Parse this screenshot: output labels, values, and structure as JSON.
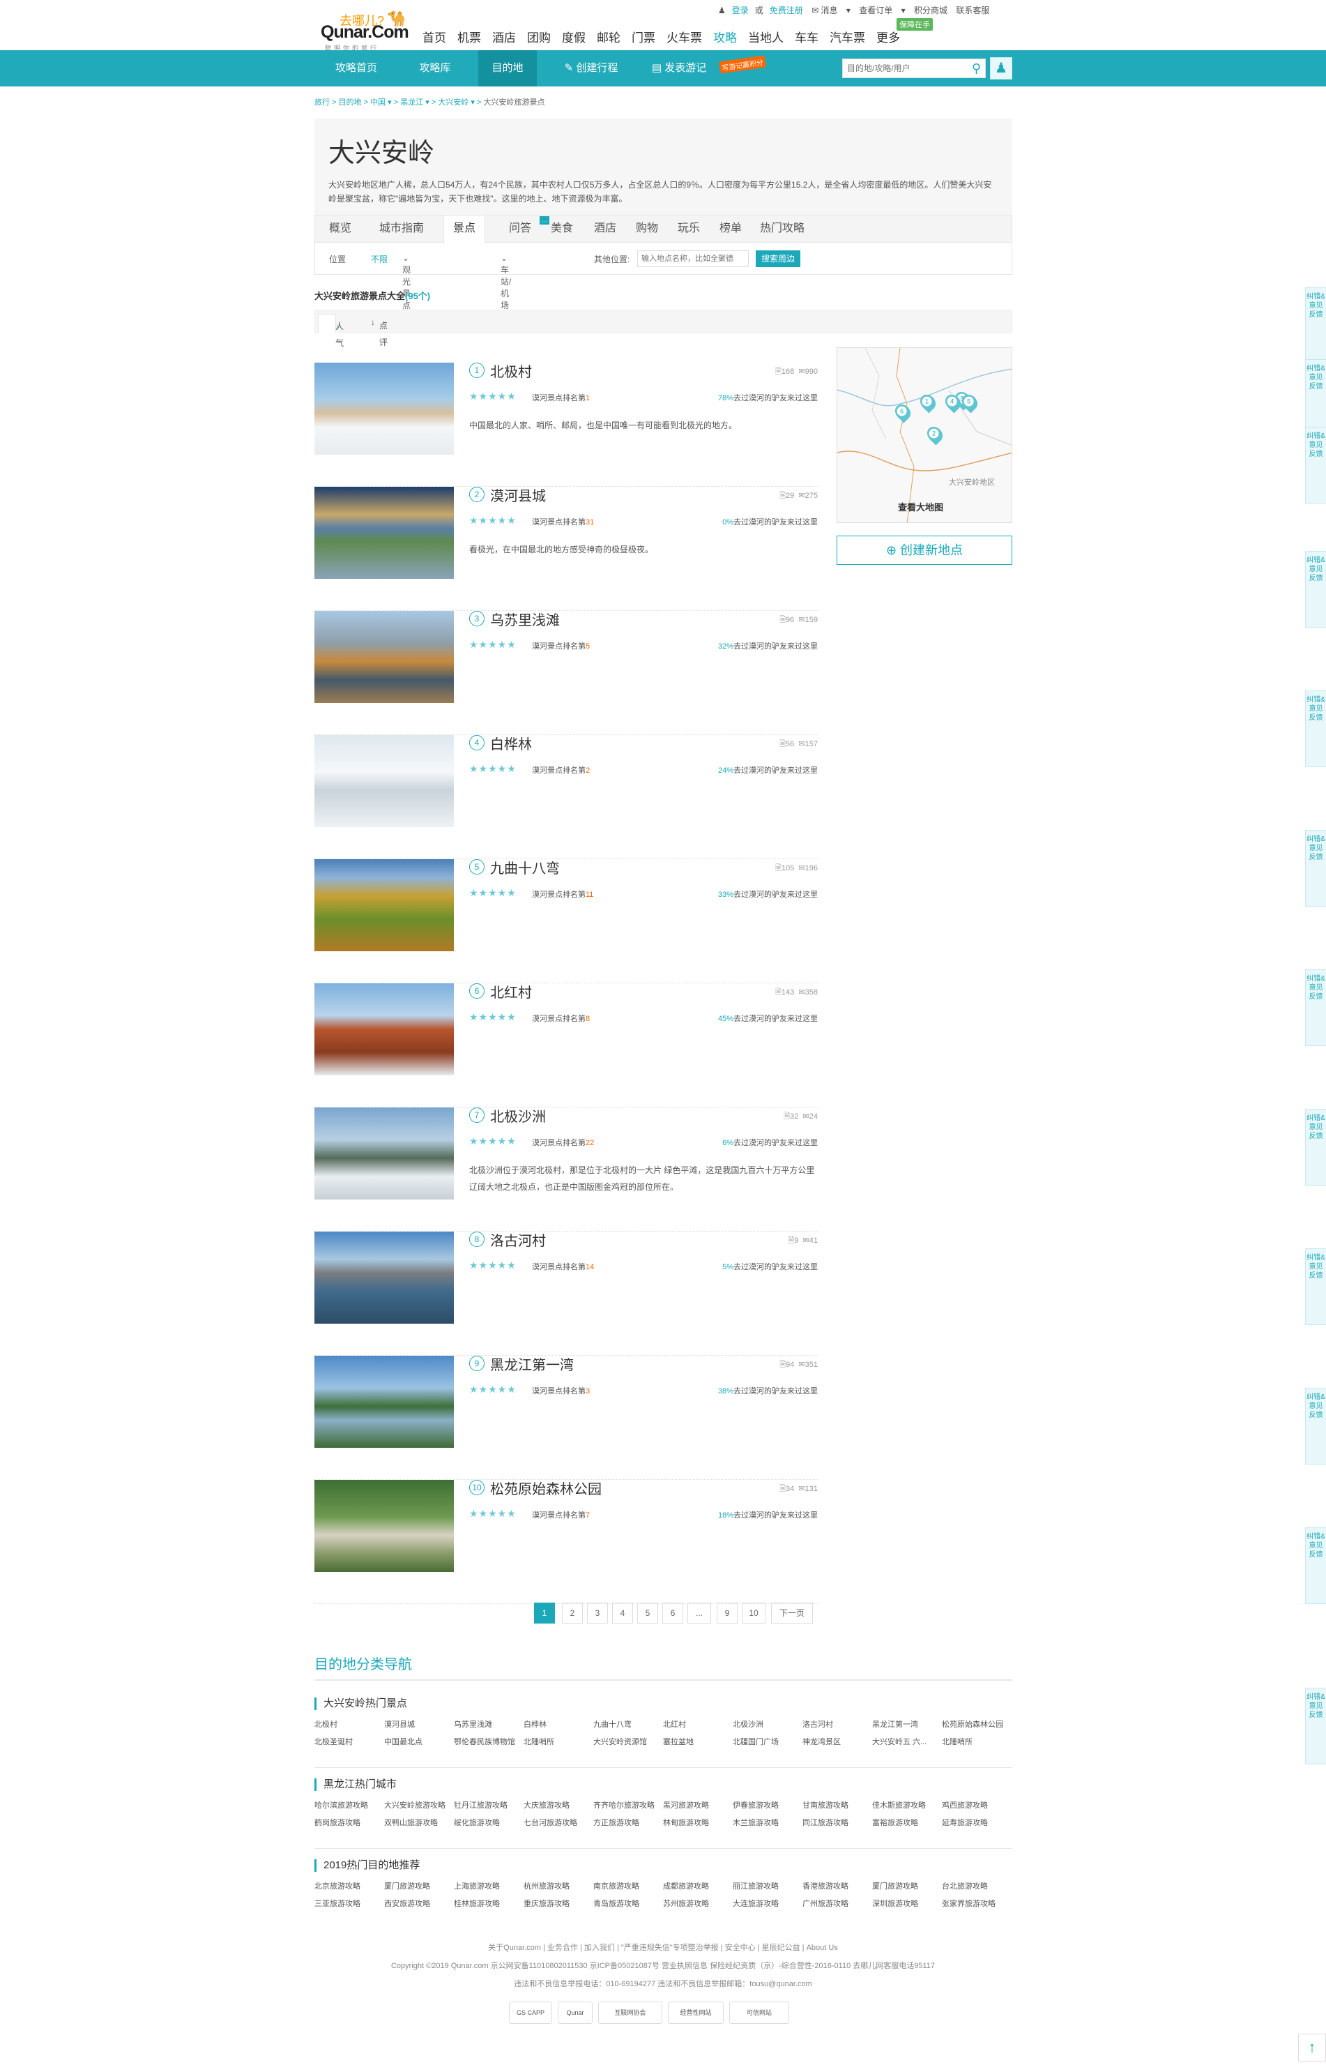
{
  "header": {
    "logo_top": "去哪儿?",
    "logo_main": "Qunar.Com",
    "logo_sub": "聪明你的旅行",
    "login": "登录",
    "or": "或",
    "register": "免费注册",
    "messages": "消息",
    "orders": "查看订单",
    "points_mall": "积分商城",
    "service": "联系客服",
    "guarantee_badge": "保障在手",
    "nav": [
      "首页",
      "机票",
      "酒店",
      "团购",
      "度假",
      "邮轮",
      "门票",
      "火车票",
      "攻略",
      "当地人",
      "车车",
      "汽车票",
      "更多"
    ]
  },
  "subnav": {
    "items": [
      "攻略首页",
      "攻略库",
      "目的地",
      "创建行程",
      "发表游记"
    ],
    "new_tag": "写游记赢积分",
    "search_placeholder": "目的地/攻略/用户"
  },
  "breadcrumb": [
    "旅行",
    "目的地",
    "中国",
    "黑龙江",
    "大兴安岭",
    "大兴安岭旅游景点"
  ],
  "destination": {
    "title": "大兴安岭",
    "intro": "大兴安岭地区地广人稀，总人口54万人，有24个民族，其中农村人口仅5万多人，占全区总人口的9％。人口密度为每平方公里15.2人，是全省人均密度最低的地区。人们赞美大兴安岭是聚宝盆，称它\"遍地皆为宝，天下也难找\"。这里的地上、地下资源极为丰富。"
  },
  "tabs": [
    "概览",
    "城市指南",
    "景点",
    "问答",
    "美食",
    "酒店",
    "购物",
    "玩乐",
    "榜单",
    "热门攻略"
  ],
  "filter": {
    "location": "位置",
    "any": "不限",
    "scenic": "观光景点",
    "station": "车站/机场",
    "other": "其他位置:",
    "input_placeholder": "输入地点名称，比如全聚德",
    "search_btn": "搜索周边"
  },
  "summary": {
    "text": "大兴安岭旅游景点大全",
    "count": "(95个)"
  },
  "sort": [
    "人气",
    "点评"
  ],
  "pois": [
    {
      "idx": "1",
      "name": "北极村",
      "notes": "168",
      "comments": "990",
      "rank_label": "漠河景点排名第",
      "rank": "1",
      "pct": "78%",
      "pct_text": "去过漠河的驴友来过这里",
      "desc": "中国最北的人家、哨所、邮局，也是中国唯一有可能看到北极光的地方。",
      "stars": "★★★★★"
    },
    {
      "idx": "2",
      "name": "漠河县城",
      "notes": "29",
      "comments": "275",
      "rank_label": "漠河景点排名第",
      "rank": "31",
      "pct": "0%",
      "pct_text": "去过漠河的驴友来过这里",
      "desc": "看极光，在中国最北的地方感受神奇的极昼极夜。",
      "stars": "★★★★★"
    },
    {
      "idx": "3",
      "name": "乌苏里浅滩",
      "notes": "96",
      "comments": "159",
      "rank_label": "漠河景点排名第",
      "rank": "5",
      "pct": "32%",
      "pct_text": "去过漠河的驴友来过这里",
      "desc": "",
      "stars": "★★★★★"
    },
    {
      "idx": "4",
      "name": "白桦林",
      "notes": "56",
      "comments": "157",
      "rank_label": "漠河景点排名第",
      "rank": "2",
      "pct": "24%",
      "pct_text": "去过漠河的驴友来过这里",
      "desc": "",
      "stars": "★★★★★"
    },
    {
      "idx": "5",
      "name": "九曲十八弯",
      "notes": "105",
      "comments": "196",
      "rank_label": "漠河景点排名第",
      "rank": "11",
      "pct": "33%",
      "pct_text": "去过漠河的驴友来过这里",
      "desc": "",
      "stars": "★★★★★"
    },
    {
      "idx": "6",
      "name": "北红村",
      "notes": "143",
      "comments": "358",
      "rank_label": "漠河景点排名第",
      "rank": "8",
      "pct": "45%",
      "pct_text": "去过漠河的驴友来过这里",
      "desc": "",
      "stars": "★★★★★"
    },
    {
      "idx": "7",
      "name": "北极沙洲",
      "notes": "32",
      "comments": "24",
      "rank_label": "漠河景点排名第",
      "rank": "22",
      "pct": "6%",
      "pct_text": "去过漠河的驴友来过这里",
      "desc": "北极沙洲位于漠河北极村，那是位于北极村的一大片 绿色平滩，这是我国九百六十万平方公里辽阔大地之北极点，也正是中国版图金鸡冠的部位所在。",
      "stars": "★★★★★"
    },
    {
      "idx": "8",
      "name": "洛古河村",
      "notes": "9",
      "comments": "41",
      "rank_label": "漠河景点排名第",
      "rank": "14",
      "pct": "5%",
      "pct_text": "去过漠河的驴友来过这里",
      "desc": "",
      "stars": "★★★★★"
    },
    {
      "idx": "9",
      "name": "黑龙江第一湾",
      "notes": "94",
      "comments": "351",
      "rank_label": "漠河景点排名第",
      "rank": "3",
      "pct": "38%",
      "pct_text": "去过漠河的驴友来过这里",
      "desc": "",
      "stars": "★★★★★"
    },
    {
      "idx": "10",
      "name": "松苑原始森林公园",
      "notes": "34",
      "comments": "131",
      "rank_label": "漠河景点排名第",
      "rank": "7",
      "pct": "18%",
      "pct_text": "去过漠河的驴友来过这里",
      "desc": "",
      "stars": "★★★★★"
    }
  ],
  "map": {
    "label": "查看大地图",
    "area": "大兴安岭地区",
    "pins": [
      "1",
      "2",
      "3",
      "4",
      "5",
      "6"
    ],
    "create": "创建新地点"
  },
  "pager": [
    "1",
    "2",
    "3",
    "4",
    "5",
    "6",
    "...",
    "9",
    "10",
    "下一页"
  ],
  "dest_nav": {
    "title": "目的地分类导航",
    "sections": [
      {
        "title": "大兴安岭热门景点",
        "links": [
          "北极村",
          "漠河县城",
          "乌苏里浅滩",
          "白桦林",
          "九曲十八弯",
          "北红村",
          "北极沙洲",
          "洛古河村",
          "黑龙江第一湾",
          "松苑原始森林公园",
          "北极圣诞村",
          "中国最北点",
          "鄂伦春民族博物馆",
          "北陲哨所",
          "大兴安岭资源馆",
          "塞拉盆地",
          "北疆国门广场",
          "神龙湾景区",
          "大兴安岭五 六...",
          "北陲哨所"
        ]
      },
      {
        "title": "黑龙江热门城市",
        "links": [
          "哈尔滨旅游攻略",
          "大兴安岭旅游攻略",
          "牡丹江旅游攻略",
          "大庆旅游攻略",
          "齐齐哈尔旅游攻略",
          "黑河旅游攻略",
          "伊春旅游攻略",
          "甘南旅游攻略",
          "佳木斯旅游攻略",
          "鸡西旅游攻略",
          "鹤岗旅游攻略",
          "双鸭山旅游攻略",
          "绥化旅游攻略",
          "七台河旅游攻略",
          "方正旅游攻略",
          "林甸旅游攻略",
          "木兰旅游攻略",
          "同江旅游攻略",
          "富裕旅游攻略",
          "延寿旅游攻略"
        ]
      },
      {
        "title": "2019热门目的地推荐",
        "links": [
          "北京旅游攻略",
          "厦门旅游攻略",
          "上海旅游攻略",
          "杭州旅游攻略",
          "南京旅游攻略",
          "成都旅游攻略",
          "丽江旅游攻略",
          "香港旅游攻略",
          "厦门旅游攻略",
          "台北旅游攻略",
          "三亚旅游攻略",
          "西安旅游攻略",
          "桂林旅游攻略",
          "重庆旅游攻略",
          "青岛旅游攻略",
          "苏州旅游攻略",
          "大连旅游攻略",
          "广州旅游攻略",
          "深圳旅游攻略",
          "张家界旅游攻略"
        ]
      }
    ]
  },
  "footer": {
    "line1": "关于Qunar.com | 业务合作 | 加入我们 | \"严重违规失信\"专项整治举报 | 安全中心 | 星辰纪公益 | About Us",
    "line2": "Copyright ©2019 Qunar.com  京公网安备11010802011530  京ICP备05021087号  营业执照信息  保险经纪资质（京）-综合营性-2016-0110  去哪儿网客服电话95117",
    "line3": "违法和不良信息举报电话：010-69194277  违法和不良信息举报邮箱：tousu@qunar.com",
    "badges": [
      "GS CAPP",
      "Qunar",
      "互联网协会",
      "经营性网站",
      "可信网站"
    ]
  },
  "side_tab": "纠错&意见反馈",
  "to_top": "↑"
}
